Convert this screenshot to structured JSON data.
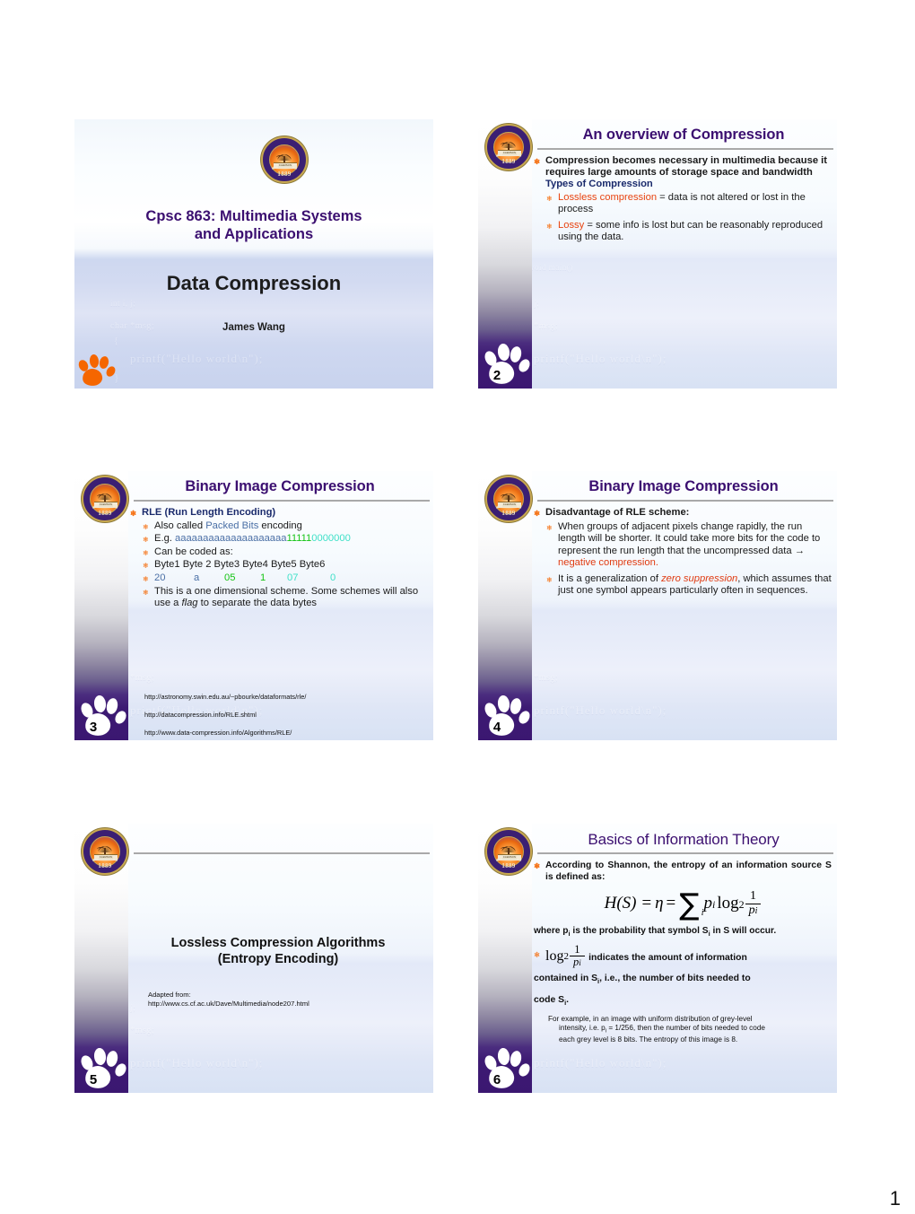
{
  "document": {
    "page_number": "1"
  },
  "slide1": {
    "logo": "clemson-seal",
    "course": "Cpsc 863: Multimedia Systems and Applications",
    "course_line1": "Cpsc 863: Multimedia Systems",
    "course_line2": "and Applications",
    "title": "Data Compression",
    "author": "James Wang"
  },
  "slide2": {
    "number": "2",
    "title": "An overview of Compression",
    "b1": "Compression becomes necessary in multimedia because it requires large amounts of storage space and bandwidth",
    "b2": "Types of Compression",
    "b3_term": "Lossless compression",
    "b3_rest": " = data is not altered or lost in the process",
    "b4_term": "Lossy",
    "b4_rest": " = some info is lost but can be reasonably reproduced using the data."
  },
  "slide3": {
    "number": "3",
    "title": "Binary Image Compression",
    "b1": "RLE (Run Length Encoding)",
    "b2_pre": "Also called ",
    "b2_hl": "Packed Bits",
    "b2_post": " encoding",
    "b3_pre": "E.g. ",
    "b3_a": "aaaaaaaaaaaaaaaaaaaa",
    "b3_ones": "11111",
    "b3_zeros": "0000000",
    "b4": "Can be coded as:",
    "b5": "Byte1 Byte 2 Byte3    Byte4 Byte5 Byte6",
    "b6_c1": "20",
    "b6_c2": "a",
    "b6_c3": "05",
    "b6_c4": "1",
    "b6_c5": "07",
    "b6_c6": "0",
    "b7_pre": "This is a one dimensional scheme. Some schemes will also use a ",
    "b7_ital": "flag",
    "b7_post": " to separate the data bytes",
    "link1": "http://astronomy.swin.edu.au/~pbourke/dataformats/rle/",
    "link2": "http://datacompression.info/RLE.shtml",
    "link3": "http://www.data-compression.info/Algorithms/RLE/"
  },
  "slide4": {
    "number": "4",
    "title": "Binary Image Compression",
    "b1": "Disadvantage of RLE scheme:",
    "b2_pre": "When groups of adjacent pixels change rapidly, the run length will be shorter. It could take more bits for the code to represent the run length that the uncompressed data ",
    "b2_arrow": "→",
    "b2_hl": " negative compression",
    "b2_post": ".",
    "b3_pre": "It is a generalization of ",
    "b3_ital": "zero suppression",
    "b3_post": ", which assumes that just one symbol appears particularly often in sequences."
  },
  "slide5": {
    "number": "5",
    "title_line1": "Lossless Compression Algorithms",
    "title_line2": "(Entropy Encoding)",
    "note_line1": "Adapted from:",
    "note_line2": "http://www.cs.cf.ac.uk/Dave/Multimedia/node207.html"
  },
  "slide6": {
    "number": "6",
    "title": "Basics of Information Theory",
    "b1": "According to Shannon, the entropy of an information source S is defined as:",
    "formula_plain": "H(S) = η = Σi pi log2 (1/pi)",
    "formula": {
      "lhs": "H(S) =",
      "eta": "η",
      "eq": "=",
      "sigma": "∑",
      "sigma_sub": "i",
      "p": "p",
      "p_sub": "i",
      "log": "log",
      "log_base": "2",
      "num": "1",
      "den": "p",
      "den_sub": "i"
    },
    "where": "where p",
    "where_sub": "i",
    "where_rest": " is the probability that symbol S",
    "where_sub2": "i",
    "where_rest2": " in S will occur.",
    "b2_after": " indicates  the  amount  of  information",
    "b2_line2": "contained in S",
    "b2_line2_sub": "i",
    "b2_line2_rest": ", i.e., the number of bits needed to",
    "b2_line3": "code S",
    "b2_line3_sub": "i",
    "b2_line3_rest": ".",
    "example_l1": "For  example,  in  an  image  with  uniform  distribution  of  grey-level",
    "example_l2": "intensity,  i.e.  p",
    "example_l2_sub": "i",
    "example_l2_rest": " = 1/256,  then  the  number  of  bits  needed  to  code",
    "example_l3": "each grey level is 8 bits. The entropy of this image is 8."
  },
  "watermark": {
    "l1": "void main()",
    "l2": "{",
    "l3": "int i, j;",
    "l4": "char *msg;",
    "l5": "{",
    "l6": "printf(\"Hello world\\n\");",
    "l7": "}"
  },
  "colors": {
    "title_purple": "#3b0f70",
    "heading_navy": "#1a2a6b",
    "bullet_orange": "#f56600",
    "highlight_red": "#e8430f",
    "steel_blue": "#4a6fa5",
    "bright_green": "#13c413",
    "cyan": "#3fe0c8",
    "sidebar_purple": "#3b1771",
    "seal_gold": "#c8a951"
  }
}
